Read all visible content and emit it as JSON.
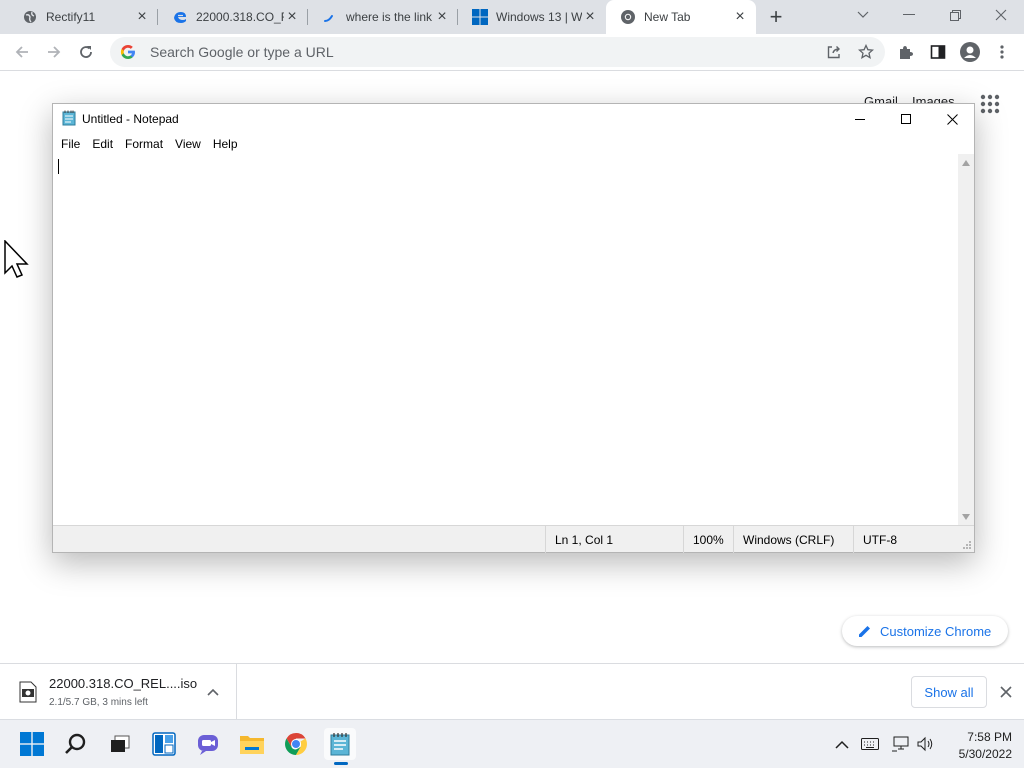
{
  "browser": {
    "tabs": [
      {
        "title": "Rectify11",
        "icon": "globe-icon",
        "active": false
      },
      {
        "title": "22000.318.CO_R",
        "icon": "edge-icon",
        "active": false
      },
      {
        "title": "where is the link",
        "icon": "loading-icon",
        "active": false
      },
      {
        "title": "Windows 13 | W",
        "icon": "windows-icon",
        "active": false
      },
      {
        "title": "New Tab",
        "icon": "chrome-icon",
        "active": true
      }
    ],
    "omnibox_placeholder": "Search Google or type a URL"
  },
  "ntp": {
    "gmail_label": "Gmail",
    "images_label": "Images",
    "customize_label": "Customize Chrome"
  },
  "notepad": {
    "title": "Untitled - Notepad",
    "menu": [
      "File",
      "Edit",
      "Format",
      "View",
      "Help"
    ],
    "content": "",
    "status": {
      "position": "Ln 1, Col 1",
      "zoom": "100%",
      "line_ending": "Windows (CRLF)",
      "encoding": "UTF-8"
    }
  },
  "downloads": {
    "filename": "22000.318.CO_REL....iso",
    "status": "2.1/5.7 GB, 3 mins left",
    "show_all_label": "Show all"
  },
  "taskbar": {
    "apps": [
      "start",
      "search",
      "task-view",
      "widgets",
      "teams-chat",
      "file-explorer",
      "chrome",
      "notepad"
    ],
    "active_app": "notepad",
    "time": "7:58 PM",
    "date": "5/30/2022"
  },
  "colors": {
    "tabstrip_bg": "#dee1e6",
    "accent_blue": "#1a73e8",
    "taskbar_bg": "#eef0f4",
    "windows_blue": "#0067c0"
  }
}
